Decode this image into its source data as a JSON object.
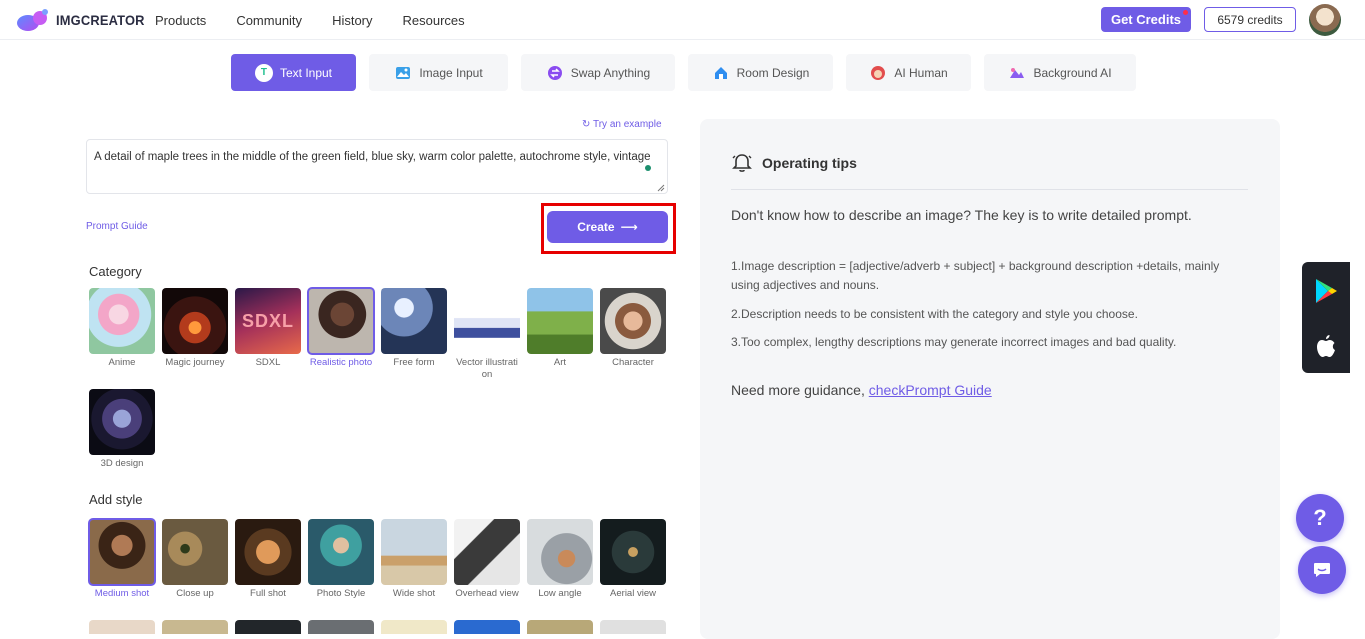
{
  "header": {
    "logo_text": "IMGCREATOR",
    "nav": [
      "Products",
      "Community",
      "History",
      "Resources"
    ],
    "get_credits": "Get Credits",
    "credits": "6579 credits"
  },
  "tabs": [
    {
      "label": "Text Input",
      "icon": "text-icon",
      "active": true
    },
    {
      "label": "Image Input",
      "icon": "image-icon",
      "active": false
    },
    {
      "label": "Swap Anything",
      "icon": "swap-icon",
      "active": false
    },
    {
      "label": "Room Design",
      "icon": "house-icon",
      "active": false
    },
    {
      "label": "AI Human",
      "icon": "human-icon",
      "active": false
    },
    {
      "label": "Background AI",
      "icon": "background-icon",
      "active": false
    }
  ],
  "prompt": {
    "try_example": "Try an example",
    "text": "A detail of maple trees in the middle of the green field, blue sky, warm color palette, autochrome style, vintage",
    "guide_link": "Prompt Guide",
    "create_label": "Create",
    "create_arrow": "⟶"
  },
  "category": {
    "title": "Category",
    "items": [
      {
        "label": "Anime",
        "selected": false
      },
      {
        "label": "Magic journey",
        "selected": false
      },
      {
        "label": "SDXL",
        "selected": false
      },
      {
        "label": "Realistic photo",
        "selected": true
      },
      {
        "label": "Free form",
        "selected": false
      },
      {
        "label": "Vector illustration",
        "selected": false
      },
      {
        "label": "Art",
        "selected": false
      },
      {
        "label": "Character",
        "selected": false
      },
      {
        "label": "3D design",
        "selected": false
      }
    ],
    "sdxl_overlay": "SDXL"
  },
  "style": {
    "title": "Add style",
    "items": [
      {
        "label": "Medium shot",
        "selected": true
      },
      {
        "label": "Close up",
        "selected": false
      },
      {
        "label": "Full shot",
        "selected": false
      },
      {
        "label": "Photo Style",
        "selected": false
      },
      {
        "label": "Wide shot",
        "selected": false
      },
      {
        "label": "Overhead view",
        "selected": false
      },
      {
        "label": "Low angle",
        "selected": false
      },
      {
        "label": "Aerial view",
        "selected": false
      }
    ]
  },
  "tips": {
    "title": "Operating tips",
    "intro": "Don't know how to describe an image? The key is to write detailed prompt.",
    "items": [
      "1.Image description = [adjective/adverb + subject] + background description +details, mainly using adjectives and nouns.",
      "2.Description needs to be consistent with the category and style you choose.",
      "3.Too complex, lengthy descriptions may generate incorrect images and bad quality."
    ],
    "guidance_prefix": "Need more guidance, ",
    "guidance_link": "checkPrompt Guide"
  },
  "floating": {
    "help": "?"
  },
  "colors": {
    "accent": "#6f5ce6",
    "highlight": "#e60000",
    "panel": "#f5f6f8"
  }
}
